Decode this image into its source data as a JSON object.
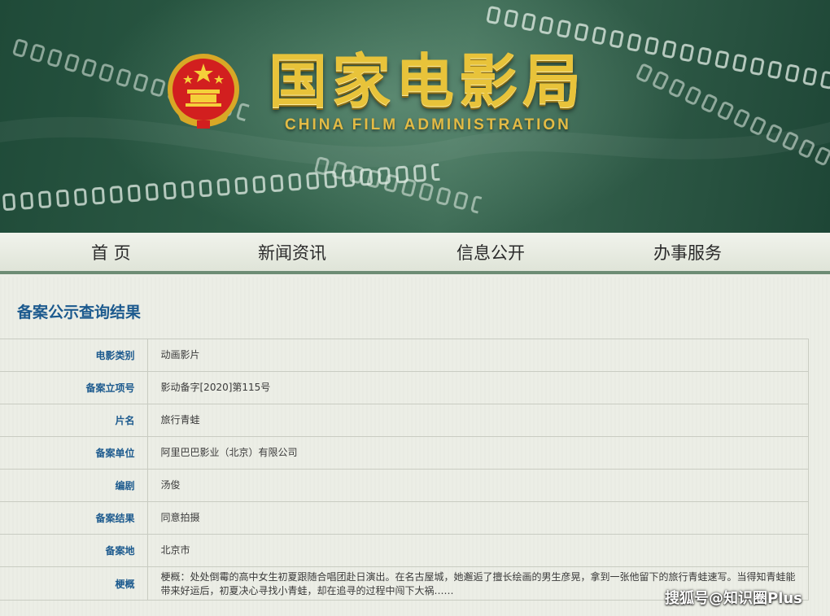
{
  "banner": {
    "title_cn": "国家电影局",
    "title_en": "CHINA FILM ADMINISTRATION",
    "emblem_icon": "national-emblem-icon",
    "colors": {
      "background": "#2f5e48",
      "title_gold": "#e8c33a",
      "emblem_red": "#d21f1f"
    }
  },
  "nav": {
    "items": [
      {
        "label": "首 页"
      },
      {
        "label": "新闻资讯"
      },
      {
        "label": "信息公开"
      },
      {
        "label": "办事服务"
      }
    ]
  },
  "main": {
    "title": "备案公示查询结果",
    "rows": [
      {
        "label": "电影类别",
        "value": "动画影片"
      },
      {
        "label": "备案立项号",
        "value": "影动备字[2020]第115号"
      },
      {
        "label": "片名",
        "value": "旅行青蛙"
      },
      {
        "label": "备案单位",
        "value": "阿里巴巴影业（北京）有限公司"
      },
      {
        "label": "编剧",
        "value": "汤俊"
      },
      {
        "label": "备案结果",
        "value": "同意拍摄"
      },
      {
        "label": "备案地",
        "value": "北京市"
      },
      {
        "label": "梗概",
        "value": "梗概：处处倒霉的高中女生初夏跟随合唱团赴日演出。在名古屋城，她邂逅了擅长绘画的男生彦晃，拿到一张他留下的旅行青蛙速写。当得知青蛙能带来好运后，初夏决心寻找小青蛙，却在追寻的过程中闯下大祸……"
      }
    ]
  },
  "watermark": "搜狐号@知识圈Plus"
}
